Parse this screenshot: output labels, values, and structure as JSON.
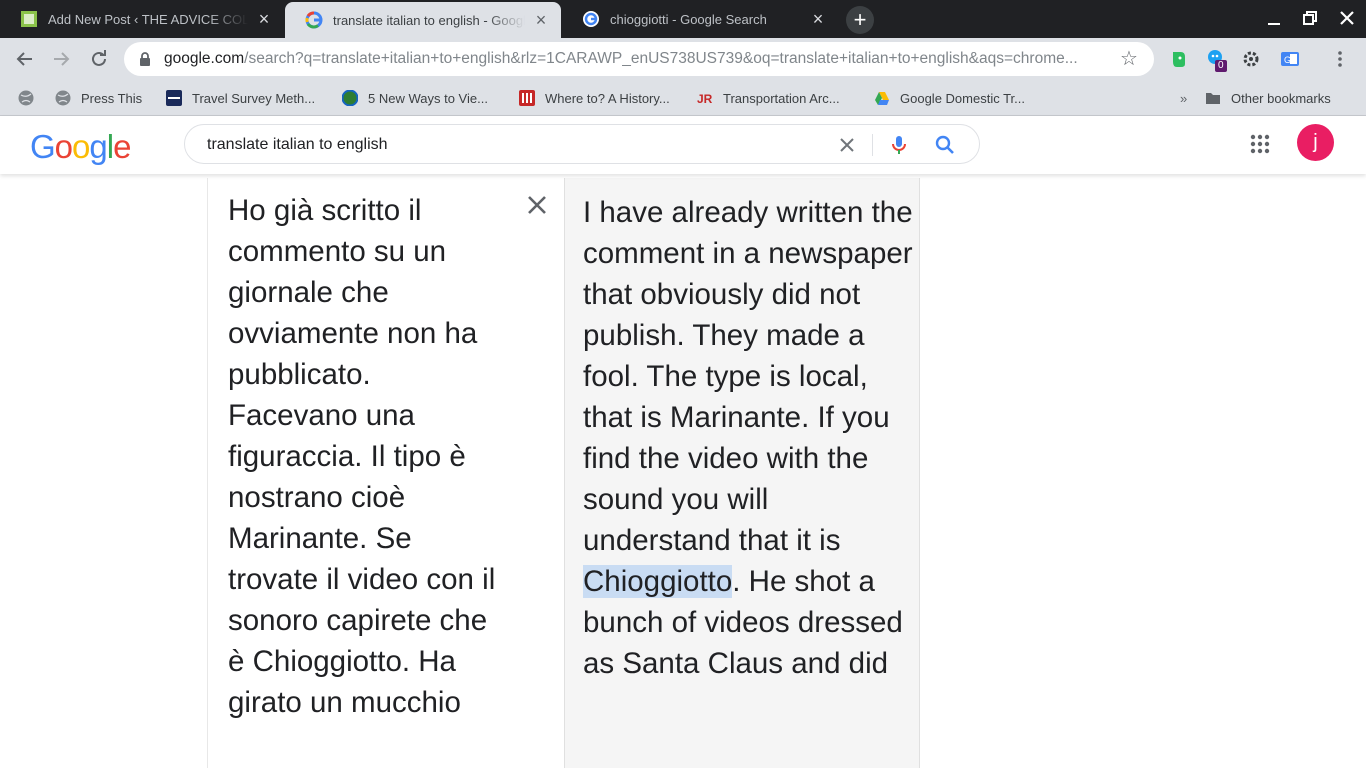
{
  "tabs": [
    {
      "title": "Add New Post ‹ THE ADVICE COLUMN",
      "active": false
    },
    {
      "title": "translate italian to english - Google Search",
      "active": true
    },
    {
      "title": "chioggiotti - Google Search",
      "active": false
    }
  ],
  "omnibox": {
    "host": "google.com",
    "path": "/search?q=translate+italian+to+english&rlz=1CARAWP_enUS738US739&oq=translate+italian+to+english&aqs=chrome..."
  },
  "extensions": {
    "badge_count": "0"
  },
  "bookmarks": [
    {
      "label": "Press This"
    },
    {
      "label": "Travel Survey Meth..."
    },
    {
      "label": "5 New Ways to Vie..."
    },
    {
      "label": "Where to? A History..."
    },
    {
      "label": "Transportation Arc..."
    },
    {
      "label": "Google Domestic Tr..."
    }
  ],
  "bookmarks_overflow": "»",
  "other_bookmarks": "Other bookmarks",
  "search": {
    "query": "translate italian to english"
  },
  "avatar_letter": "j",
  "translation": {
    "source_text": "Ho già scritto il commento su un giornale che ovviamente non ha pubblicato. Facevano una figuraccia. Il tipo è nostrano cioè Marinante. Se trovate il video con il sonoro capirete che è Chioggiotto. Ha girato un mucchio",
    "target_before": "I have already written the comment in a newspaper that obviously did not publish. They made a fool. The type is local, that is Marinante. If you find the video with the sound you will understand that it is ",
    "target_highlight": "Chioggiotto",
    "target_after": ". He shot a bunch of videos dressed as Santa Claus and did"
  }
}
